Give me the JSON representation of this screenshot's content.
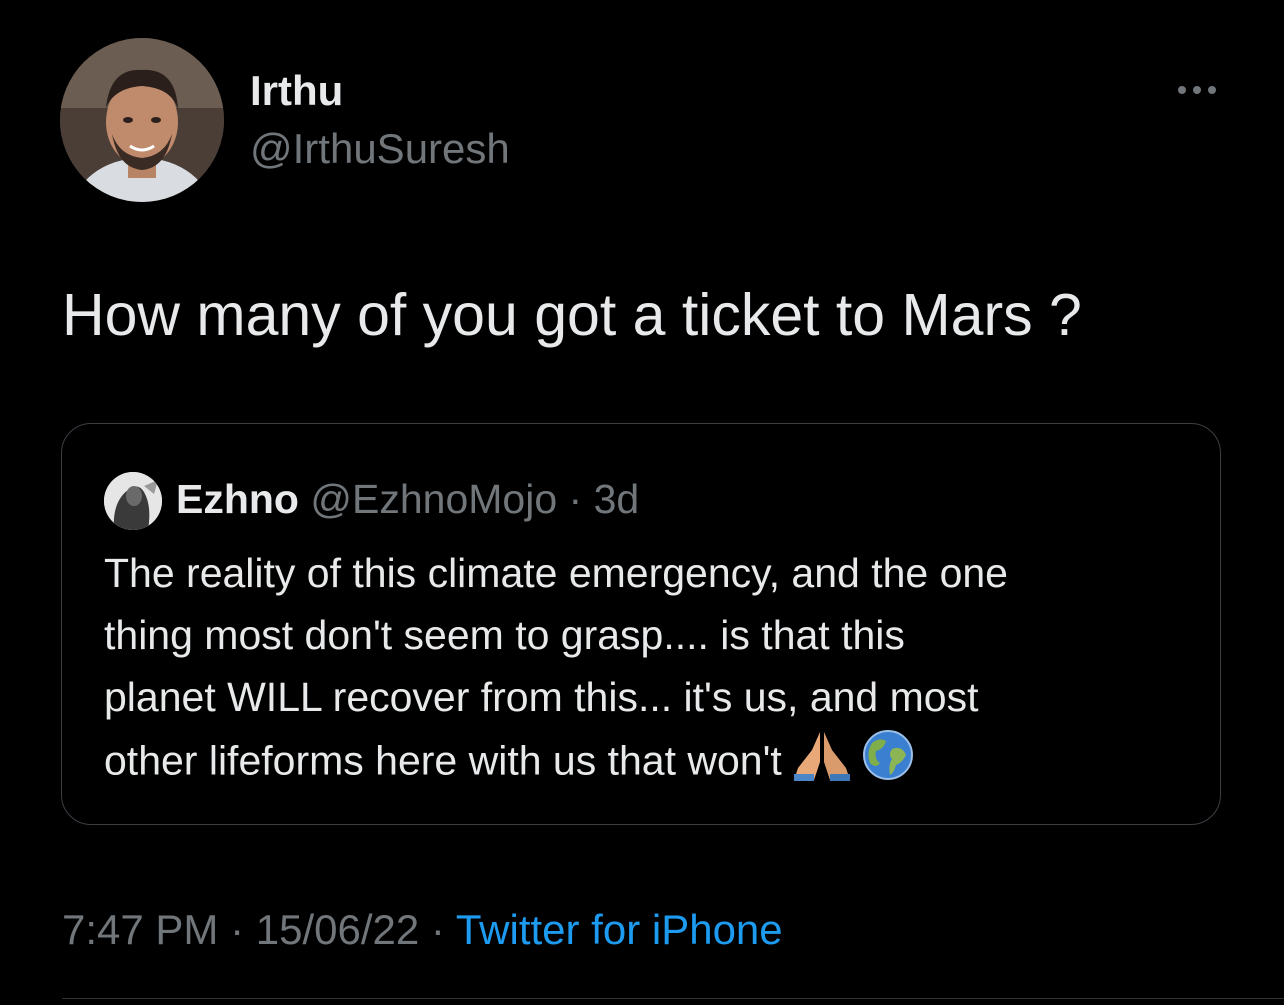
{
  "author": {
    "display_name": "Irthu",
    "handle": "@IrthuSuresh"
  },
  "tweet": {
    "text": "How many of you got a ticket to Mars ?"
  },
  "quoted_tweet": {
    "display_name": "Ezhno",
    "handle": "@EzhnoMojo",
    "separator": "·",
    "age": "3d",
    "lines": [
      "The reality of this climate emergency, and the one",
      "thing most don't seem to grasp.... is that this",
      "planet WILL recover from this... it's us, and most",
      "other lifeforms here with us that won't"
    ],
    "emojis": [
      "folded-hands-icon",
      "globe-icon"
    ]
  },
  "meta": {
    "time": "7:47 PM",
    "separator": " · ",
    "date": "15/06/22",
    "source": "Twitter for iPhone"
  },
  "colors": {
    "background": "#000000",
    "text_primary": "#e7e9ea",
    "text_secondary": "#71767b",
    "link": "#1d9bf0",
    "border": "#3b3f44"
  }
}
